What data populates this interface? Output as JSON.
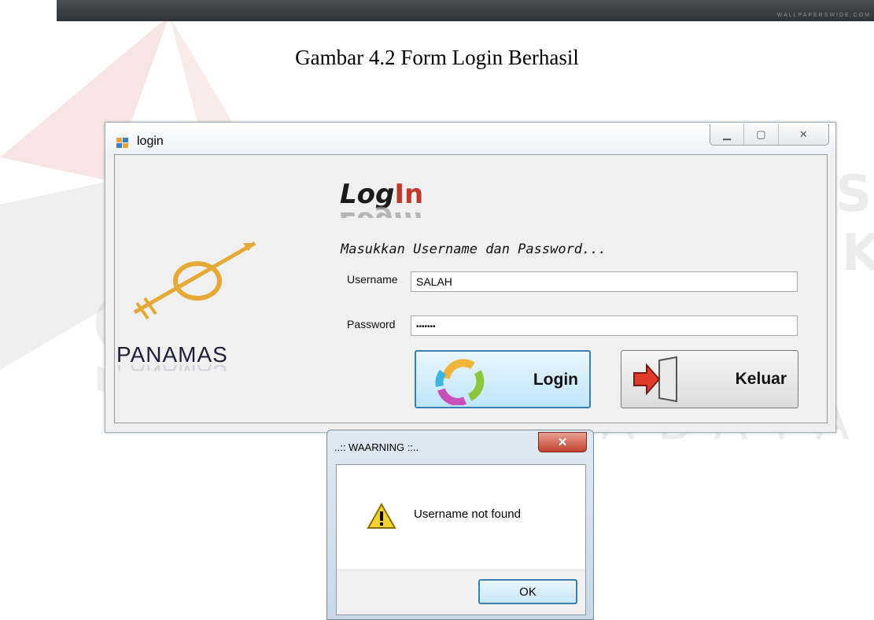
{
  "caption": "Gambar 4.2 Form Login Berhasil",
  "watermark": {
    "line1": "INSTITUT BISNIS",
    "line2": "& INFORMATIKA",
    "line3": "stikom",
    "line4": "SURABAYA"
  },
  "top_strip": {
    "small_text": "WALLPAPERSWIDE.COM"
  },
  "login_window": {
    "title": "login",
    "controls": {
      "minimize_icon": "minimize-icon",
      "maximize_icon": "maximize-icon",
      "close_icon": "close-icon"
    },
    "logo_text": "PANAMAS",
    "heading_part1": "Log",
    "heading_part2": "In",
    "subtitle": "Masukkan Username dan Password...",
    "username_label": "Username",
    "username_value": "SALAH",
    "password_label": "Password",
    "password_value": "•••••••",
    "login_button_label": "Login",
    "exit_button_label": "Keluar",
    "accent_color": "#c0392b"
  },
  "warning_dialog": {
    "title": "..:: WAARNING ::..",
    "message": "Username not found",
    "ok_label": "OK",
    "icon": "warning-icon"
  }
}
